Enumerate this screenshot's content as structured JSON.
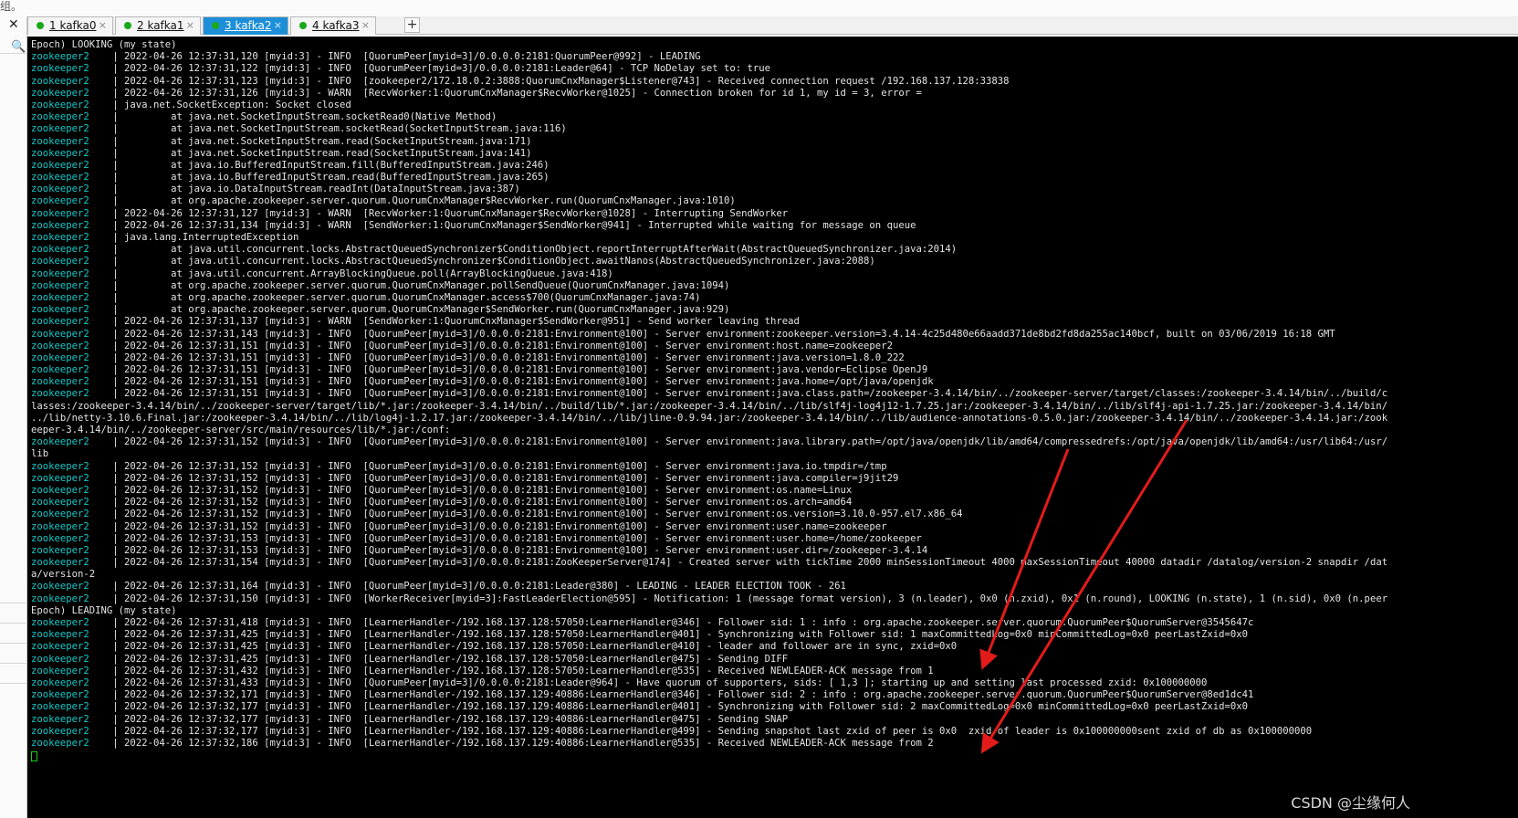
{
  "corner_fragment": "组。",
  "tabs": [
    {
      "label": "1 kafka0",
      "active": false
    },
    {
      "label": "2 kafka1",
      "active": false
    },
    {
      "label": "3 kafka2",
      "active": true
    },
    {
      "label": "4 kafka3",
      "active": false
    }
  ],
  "add_tab_glyph": "+",
  "close_glyph": "×",
  "panel_close_glyph": "✕",
  "panel_search_glyph": "🔍",
  "colors": {
    "prefix": "#17c8c8",
    "text": "#e4e4e4",
    "active_tab": "#1d8fd8",
    "arrow": "#e31b1b",
    "dot": "#1aa81a"
  },
  "terminal": {
    "lines": [
      {
        "p": "",
        "t": "Epoch) LOOKING (my state)"
      },
      {
        "p": "zookeeper2    ",
        "t": "| 2022-04-26 12:37:31,120 [myid:3] - INFO  [QuorumPeer[myid=3]/0.0.0.0:2181:QuorumPeer@992] - LEADING"
      },
      {
        "p": "zookeeper2    ",
        "t": "| 2022-04-26 12:37:31,122 [myid:3] - INFO  [QuorumPeer[myid=3]/0.0.0.0:2181:Leader@64] - TCP NoDelay set to: true"
      },
      {
        "p": "zookeeper2    ",
        "t": "| 2022-04-26 12:37:31,123 [myid:3] - INFO  [zookeeper2/172.18.0.2:3888:QuorumCnxManager$Listener@743] - Received connection request /192.168.137.128:33838"
      },
      {
        "p": "zookeeper2    ",
        "t": "| 2022-04-26 12:37:31,126 [myid:3] - WARN  [RecvWorker:1:QuorumCnxManager$RecvWorker@1025] - Connection broken for id 1, my id = 3, error ="
      },
      {
        "p": "zookeeper2    ",
        "t": "| java.net.SocketException: Socket closed"
      },
      {
        "p": "zookeeper2    ",
        "t": "|         at java.net.SocketInputStream.socketRead0(Native Method)"
      },
      {
        "p": "zookeeper2    ",
        "t": "|         at java.net.SocketInputStream.socketRead(SocketInputStream.java:116)"
      },
      {
        "p": "zookeeper2    ",
        "t": "|         at java.net.SocketInputStream.read(SocketInputStream.java:171)"
      },
      {
        "p": "zookeeper2    ",
        "t": "|         at java.net.SocketInputStream.read(SocketInputStream.java:141)"
      },
      {
        "p": "zookeeper2    ",
        "t": "|         at java.io.BufferedInputStream.fill(BufferedInputStream.java:246)"
      },
      {
        "p": "zookeeper2    ",
        "t": "|         at java.io.BufferedInputStream.read(BufferedInputStream.java:265)"
      },
      {
        "p": "zookeeper2    ",
        "t": "|         at java.io.DataInputStream.readInt(DataInputStream.java:387)"
      },
      {
        "p": "zookeeper2    ",
        "t": "|         at org.apache.zookeeper.server.quorum.QuorumCnxManager$RecvWorker.run(QuorumCnxManager.java:1010)"
      },
      {
        "p": "zookeeper2    ",
        "t": "| 2022-04-26 12:37:31,127 [myid:3] - WARN  [RecvWorker:1:QuorumCnxManager$RecvWorker@1028] - Interrupting SendWorker"
      },
      {
        "p": "zookeeper2    ",
        "t": "| 2022-04-26 12:37:31,134 [myid:3] - WARN  [SendWorker:1:QuorumCnxManager$SendWorker@941] - Interrupted while waiting for message on queue"
      },
      {
        "p": "zookeeper2    ",
        "t": "| java.lang.InterruptedException"
      },
      {
        "p": "zookeeper2    ",
        "t": "|         at java.util.concurrent.locks.AbstractQueuedSynchronizer$ConditionObject.reportInterruptAfterWait(AbstractQueuedSynchronizer.java:2014)"
      },
      {
        "p": "zookeeper2    ",
        "t": "|         at java.util.concurrent.locks.AbstractQueuedSynchronizer$ConditionObject.awaitNanos(AbstractQueuedSynchronizer.java:2088)"
      },
      {
        "p": "zookeeper2    ",
        "t": "|         at java.util.concurrent.ArrayBlockingQueue.poll(ArrayBlockingQueue.java:418)"
      },
      {
        "p": "zookeeper2    ",
        "t": "|         at org.apache.zookeeper.server.quorum.QuorumCnxManager.pollSendQueue(QuorumCnxManager.java:1094)"
      },
      {
        "p": "zookeeper2    ",
        "t": "|         at org.apache.zookeeper.server.quorum.QuorumCnxManager.access$700(QuorumCnxManager.java:74)"
      },
      {
        "p": "zookeeper2    ",
        "t": "|         at org.apache.zookeeper.server.quorum.QuorumCnxManager$SendWorker.run(QuorumCnxManager.java:929)"
      },
      {
        "p": "zookeeper2    ",
        "t": "| 2022-04-26 12:37:31,137 [myid:3] - WARN  [SendWorker:1:QuorumCnxManager$SendWorker@951] - Send worker leaving thread"
      },
      {
        "p": "zookeeper2    ",
        "t": "| 2022-04-26 12:37:31,143 [myid:3] - INFO  [QuorumPeer[myid=3]/0.0.0.0:2181:Environment@100] - Server environment:zookeeper.version=3.4.14-4c25d480e66aadd371de8bd2fd8da255ac140bcf, built on 03/06/2019 16:18 GMT"
      },
      {
        "p": "zookeeper2    ",
        "t": "| 2022-04-26 12:37:31,151 [myid:3] - INFO  [QuorumPeer[myid=3]/0.0.0.0:2181:Environment@100] - Server environment:host.name=zookeeper2"
      },
      {
        "p": "zookeeper2    ",
        "t": "| 2022-04-26 12:37:31,151 [myid:3] - INFO  [QuorumPeer[myid=3]/0.0.0.0:2181:Environment@100] - Server environment:java.version=1.8.0_222"
      },
      {
        "p": "zookeeper2    ",
        "t": "| 2022-04-26 12:37:31,151 [myid:3] - INFO  [QuorumPeer[myid=3]/0.0.0.0:2181:Environment@100] - Server environment:java.vendor=Eclipse OpenJ9"
      },
      {
        "p": "zookeeper2    ",
        "t": "| 2022-04-26 12:37:31,151 [myid:3] - INFO  [QuorumPeer[myid=3]/0.0.0.0:2181:Environment@100] - Server environment:java.home=/opt/java/openjdk"
      },
      {
        "p": "zookeeper2    ",
        "t": "| 2022-04-26 12:37:31,151 [myid:3] - INFO  [QuorumPeer[myid=3]/0.0.0.0:2181:Environment@100] - Server environment:java.class.path=/zookeeper-3.4.14/bin/../zookeeper-server/target/classes:/zookeeper-3.4.14/bin/../build/c"
      },
      {
        "p": "",
        "t": "lasses:/zookeeper-3.4.14/bin/../zookeeper-server/target/lib/*.jar:/zookeeper-3.4.14/bin/../build/lib/*.jar:/zookeeper-3.4.14/bin/../lib/slf4j-log4j12-1.7.25.jar:/zookeeper-3.4.14/bin/../lib/slf4j-api-1.7.25.jar:/zookeeper-3.4.14/bin/"
      },
      {
        "p": "",
        "t": "../lib/netty-3.10.6.Final.jar:/zookeeper-3.4.14/bin/../lib/log4j-1.2.17.jar:/zookeeper-3.4.14/bin/../lib/jline-0.9.94.jar:/zookeeper-3.4.14/bin/../lib/audience-annotations-0.5.0.jar:/zookeeper-3.4.14/bin/../zookeeper-3.4.14.jar:/zook"
      },
      {
        "p": "",
        "t": "eeper-3.4.14/bin/../zookeeper-server/src/main/resources/lib/*.jar:/conf:"
      },
      {
        "p": "zookeeper2    ",
        "t": "| 2022-04-26 12:37:31,152 [myid:3] - INFO  [QuorumPeer[myid=3]/0.0.0.0:2181:Environment@100] - Server environment:java.library.path=/opt/java/openjdk/lib/amd64/compressedrefs:/opt/java/openjdk/lib/amd64:/usr/lib64:/usr/"
      },
      {
        "p": "",
        "t": "lib"
      },
      {
        "p": "zookeeper2    ",
        "t": "| 2022-04-26 12:37:31,152 [myid:3] - INFO  [QuorumPeer[myid=3]/0.0.0.0:2181:Environment@100] - Server environment:java.io.tmpdir=/tmp"
      },
      {
        "p": "zookeeper2    ",
        "t": "| 2022-04-26 12:37:31,152 [myid:3] - INFO  [QuorumPeer[myid=3]/0.0.0.0:2181:Environment@100] - Server environment:java.compiler=j9jit29"
      },
      {
        "p": "zookeeper2    ",
        "t": "| 2022-04-26 12:37:31,152 [myid:3] - INFO  [QuorumPeer[myid=3]/0.0.0.0:2181:Environment@100] - Server environment:os.name=Linux"
      },
      {
        "p": "zookeeper2    ",
        "t": "| 2022-04-26 12:37:31,152 [myid:3] - INFO  [QuorumPeer[myid=3]/0.0.0.0:2181:Environment@100] - Server environment:os.arch=amd64"
      },
      {
        "p": "zookeeper2    ",
        "t": "| 2022-04-26 12:37:31,152 [myid:3] - INFO  [QuorumPeer[myid=3]/0.0.0.0:2181:Environment@100] - Server environment:os.version=3.10.0-957.el7.x86_64"
      },
      {
        "p": "zookeeper2    ",
        "t": "| 2022-04-26 12:37:31,152 [myid:3] - INFO  [QuorumPeer[myid=3]/0.0.0.0:2181:Environment@100] - Server environment:user.name=zookeeper"
      },
      {
        "p": "zookeeper2    ",
        "t": "| 2022-04-26 12:37:31,153 [myid:3] - INFO  [QuorumPeer[myid=3]/0.0.0.0:2181:Environment@100] - Server environment:user.home=/home/zookeeper"
      },
      {
        "p": "zookeeper2    ",
        "t": "| 2022-04-26 12:37:31,153 [myid:3] - INFO  [QuorumPeer[myid=3]/0.0.0.0:2181:Environment@100] - Server environment:user.dir=/zookeeper-3.4.14"
      },
      {
        "p": "zookeeper2    ",
        "t": "| 2022-04-26 12:37:31,154 [myid:3] - INFO  [QuorumPeer[myid=3]/0.0.0.0:2181:ZooKeeperServer@174] - Created server with tickTime 2000 minSessionTimeout 4000 maxSessionTimeout 40000 datadir /datalog/version-2 snapdir /dat"
      },
      {
        "p": "",
        "t": "a/version-2"
      },
      {
        "p": "zookeeper2    ",
        "t": "| 2022-04-26 12:37:31,164 [myid:3] - INFO  [QuorumPeer[myid=3]/0.0.0.0:2181:Leader@380] - LEADING - LEADER ELECTION TOOK - 261"
      },
      {
        "p": "zookeeper2    ",
        "t": "| 2022-04-26 12:37:31,150 [myid:3] - INFO  [WorkerReceiver[myid=3]:FastLeaderElection@595] - Notification: 1 (message format version), 3 (n.leader), 0x0 (n.zxid), 0x1 (n.round), LOOKING (n.state), 1 (n.sid), 0x0 (n.peer"
      },
      {
        "p": "",
        "t": "Epoch) LEADING (my state)"
      },
      {
        "p": "zookeeper2    ",
        "t": "| 2022-04-26 12:37:31,418 [myid:3] - INFO  [LearnerHandler-/192.168.137.128:57050:LearnerHandler@346] - Follower sid: 1 : info : org.apache.zookeeper.server.quorum.QuorumPeer$QuorumServer@3545647c"
      },
      {
        "p": "zookeeper2    ",
        "t": "| 2022-04-26 12:37:31,425 [myid:3] - INFO  [LearnerHandler-/192.168.137.128:57050:LearnerHandler@401] - Synchronizing with Follower sid: 1 maxCommittedLog=0x0 minCommittedLog=0x0 peerLastZxid=0x0"
      },
      {
        "p": "zookeeper2    ",
        "t": "| 2022-04-26 12:37:31,425 [myid:3] - INFO  [LearnerHandler-/192.168.137.128:57050:LearnerHandler@410] - leader and follower are in sync, zxid=0x0"
      },
      {
        "p": "zookeeper2    ",
        "t": "| 2022-04-26 12:37:31,425 [myid:3] - INFO  [LearnerHandler-/192.168.137.128:57050:LearnerHandler@475] - Sending DIFF"
      },
      {
        "p": "zookeeper2    ",
        "t": "| 2022-04-26 12:37:31,432 [myid:3] - INFO  [LearnerHandler-/192.168.137.128:57050:LearnerHandler@535] - Received NEWLEADER-ACK message from 1"
      },
      {
        "p": "zookeeper2    ",
        "t": "| 2022-04-26 12:37:31,433 [myid:3] - INFO  [QuorumPeer[myid=3]/0.0.0.0:2181:Leader@964] - Have quorum of supporters, sids: [ 1,3 ]; starting up and setting last processed zxid: 0x100000000"
      },
      {
        "p": "zookeeper2    ",
        "t": "| 2022-04-26 12:37:32,171 [myid:3] - INFO  [LearnerHandler-/192.168.137.129:40886:LearnerHandler@346] - Follower sid: 2 : info : org.apache.zookeeper.server.quorum.QuorumPeer$QuorumServer@8ed1dc41"
      },
      {
        "p": "zookeeper2    ",
        "t": "| 2022-04-26 12:37:32,177 [myid:3] - INFO  [LearnerHandler-/192.168.137.129:40886:LearnerHandler@401] - Synchronizing with Follower sid: 2 maxCommittedLog=0x0 minCommittedLog=0x0 peerLastZxid=0x0"
      },
      {
        "p": "zookeeper2    ",
        "t": "| 2022-04-26 12:37:32,177 [myid:3] - INFO  [LearnerHandler-/192.168.137.129:40886:LearnerHandler@475] - Sending SNAP"
      },
      {
        "p": "zookeeper2    ",
        "t": "| 2022-04-26 12:37:32,177 [myid:3] - INFO  [LearnerHandler-/192.168.137.129:40886:LearnerHandler@499] - Sending snapshot last zxid of peer is 0x0  zxid of leader is 0x100000000sent zxid of db as 0x100000000"
      },
      {
        "p": "zookeeper2    ",
        "t": "| 2022-04-26 12:37:32,186 [myid:3] - INFO  [LearnerHandler-/192.168.137.129:40886:LearnerHandler@535] - Received NEWLEADER-ACK message from 2"
      }
    ]
  },
  "watermark": "CSDN @尘缘何人"
}
